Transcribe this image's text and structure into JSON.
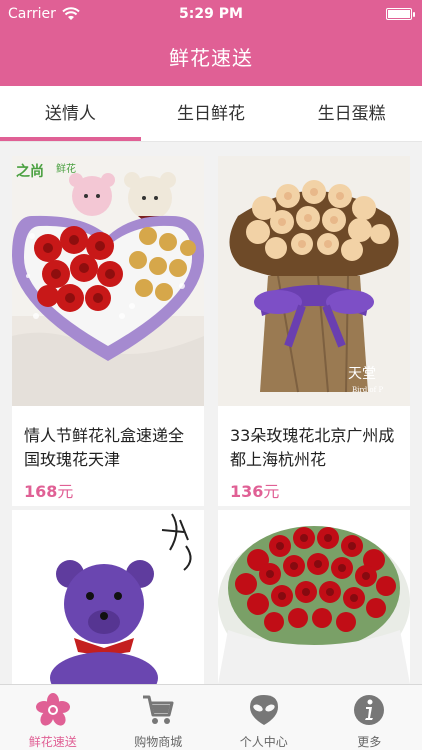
{
  "status_bar": {
    "carrier": "Carrier",
    "time": "5:29 PM"
  },
  "header": {
    "title": "鲜花速送"
  },
  "tabs": [
    {
      "label": "送情人",
      "active": true
    },
    {
      "label": "生日鲜花",
      "active": false
    },
    {
      "label": "生日蛋糕",
      "active": false
    }
  ],
  "products": [
    {
      "title": "情人节鲜花礼盒速递全国玫瑰花天津",
      "price": "168",
      "unit": "元",
      "image": "heart-box-roses-chocolates"
    },
    {
      "title": "33朵玫瑰花北京广州成都上海杭州花",
      "price": "136",
      "unit": "元",
      "image": "peach-roses-bouquet"
    },
    {
      "title": "",
      "price": "",
      "unit": "",
      "image": "purple-flower-teddy-bear"
    },
    {
      "title": "",
      "price": "",
      "unit": "",
      "image": "red-roses-round-bouquet"
    }
  ],
  "bottom_tabs": [
    {
      "label": "鲜花速送",
      "icon": "flower-icon",
      "active": true
    },
    {
      "label": "购物商城",
      "icon": "cart-icon",
      "active": false
    },
    {
      "label": "个人中心",
      "icon": "alien-icon",
      "active": false
    },
    {
      "label": "更多",
      "icon": "info-icon",
      "active": false
    }
  ],
  "colors": {
    "accent": "#e06095",
    "price": "#e06095"
  }
}
